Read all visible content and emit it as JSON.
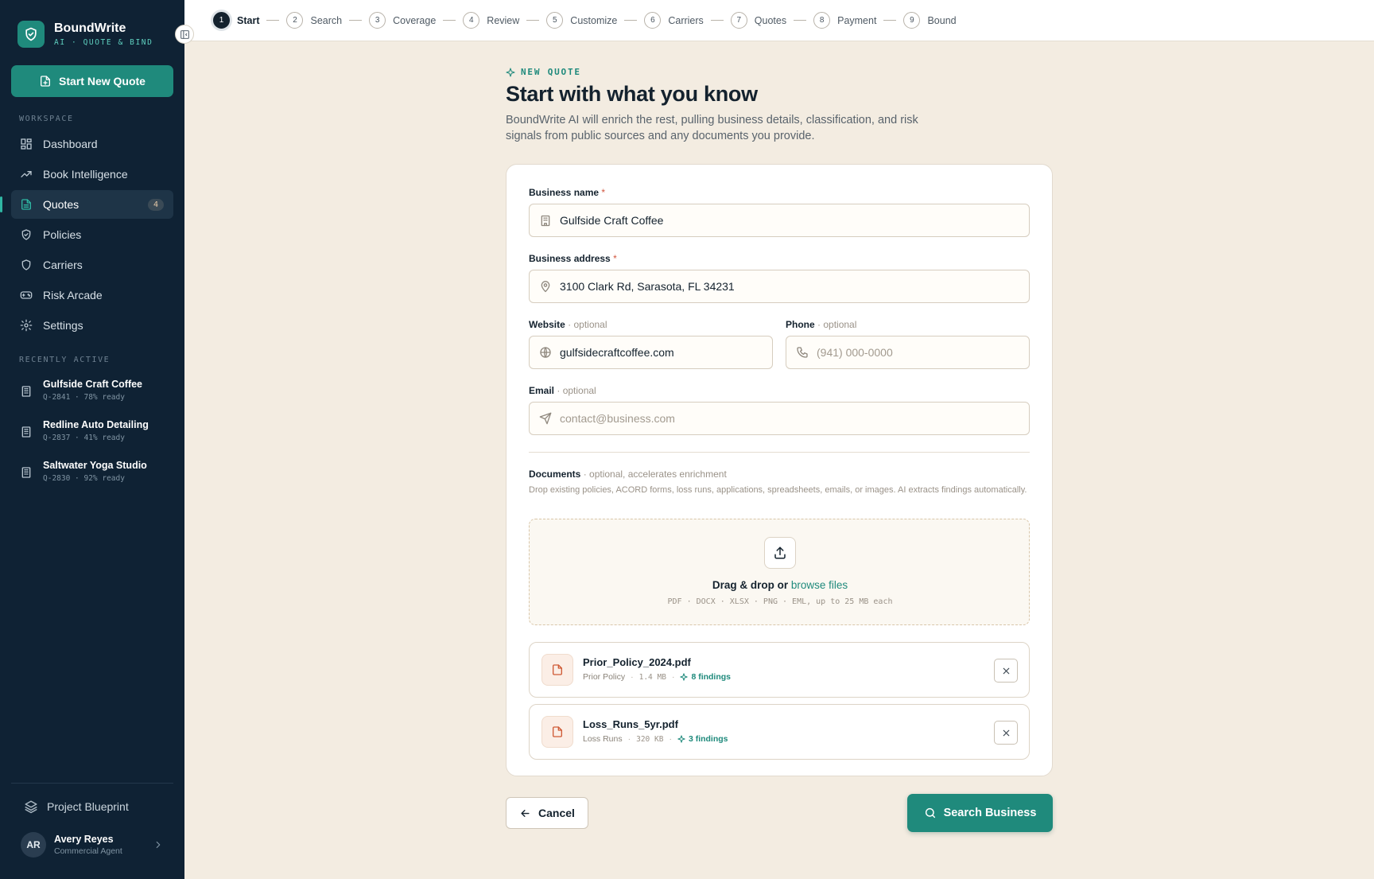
{
  "brand": {
    "name": "BoundWrite",
    "tagline": "AI · QUOTE & BIND"
  },
  "sidebar": {
    "new_quote_label": "Start New Quote",
    "workspace_label": "WORKSPACE",
    "nav": [
      {
        "label": "Dashboard",
        "icon": "dashboard-icon"
      },
      {
        "label": "Book Intelligence",
        "icon": "trend-icon"
      },
      {
        "label": "Quotes",
        "icon": "document-icon",
        "badge": "4",
        "active": true
      },
      {
        "label": "Policies",
        "icon": "shield-check-icon"
      },
      {
        "label": "Carriers",
        "icon": "shield-icon"
      },
      {
        "label": "Risk Arcade",
        "icon": "gamepad-icon"
      },
      {
        "label": "Settings",
        "icon": "gear-icon"
      }
    ],
    "recent_label": "RECENTLY ACTIVE",
    "recent": [
      {
        "name": "Gulfside Craft Coffee",
        "meta": "Q-2841 · 78% ready"
      },
      {
        "name": "Redline Auto Detailing",
        "meta": "Q-2837 · 41% ready"
      },
      {
        "name": "Saltwater Yoga Studio",
        "meta": "Q-2830 · 92% ready"
      }
    ],
    "blueprint_label": "Project Blueprint",
    "user": {
      "initials": "AR",
      "name": "Avery Reyes",
      "role": "Commercial Agent"
    }
  },
  "steps": [
    {
      "num": "1",
      "label": "Start",
      "active": true
    },
    {
      "num": "2",
      "label": "Search"
    },
    {
      "num": "3",
      "label": "Coverage"
    },
    {
      "num": "4",
      "label": "Review"
    },
    {
      "num": "5",
      "label": "Customize"
    },
    {
      "num": "6",
      "label": "Carriers"
    },
    {
      "num": "7",
      "label": "Quotes"
    },
    {
      "num": "8",
      "label": "Payment"
    },
    {
      "num": "9",
      "label": "Bound"
    }
  ],
  "main": {
    "eyebrow": "NEW QUOTE",
    "title": "Start with what you know",
    "description": "BoundWrite AI will enrich the rest, pulling business details, classification, and risk signals from public sources and any documents you provide."
  },
  "form": {
    "business_name": {
      "label": "Business name",
      "required": "*",
      "value": "Gulfside Craft Coffee"
    },
    "business_address": {
      "label": "Business address",
      "required": "*",
      "value": "3100 Clark Rd, Sarasota, FL 34231"
    },
    "website": {
      "label": "Website",
      "optional": "· optional",
      "value": "gulfsidecraftcoffee.com"
    },
    "phone": {
      "label": "Phone",
      "optional": "· optional",
      "value": "",
      "placeholder": "(941) 000-0000"
    },
    "email": {
      "label": "Email",
      "optional": "· optional",
      "value": "",
      "placeholder": "contact@business.com"
    }
  },
  "documents": {
    "label": "Documents",
    "optional": "· optional, accelerates enrichment",
    "help": "Drop existing policies, ACORD forms, loss runs, applications, spreadsheets, emails, or images. AI extracts findings automatically.",
    "drop_text": "Drag & drop or",
    "browse_label": "browse files",
    "formats": "PDF · DOCX · XLSX · PNG · EML, up to 25 MB each",
    "files": [
      {
        "name": "Prior_Policy_2024.pdf",
        "type": "Prior Policy",
        "size": "1.4 MB",
        "findings": "8 findings"
      },
      {
        "name": "Loss_Runs_5yr.pdf",
        "type": "Loss Runs",
        "size": "320 KB",
        "findings": "3 findings"
      }
    ]
  },
  "actions": {
    "cancel_label": "Cancel",
    "search_label": "Search Business"
  },
  "colors": {
    "sidebar": "#0f2234",
    "accent": "#1f8a7c",
    "background": "#f3ece1",
    "required": "#d1573f"
  }
}
